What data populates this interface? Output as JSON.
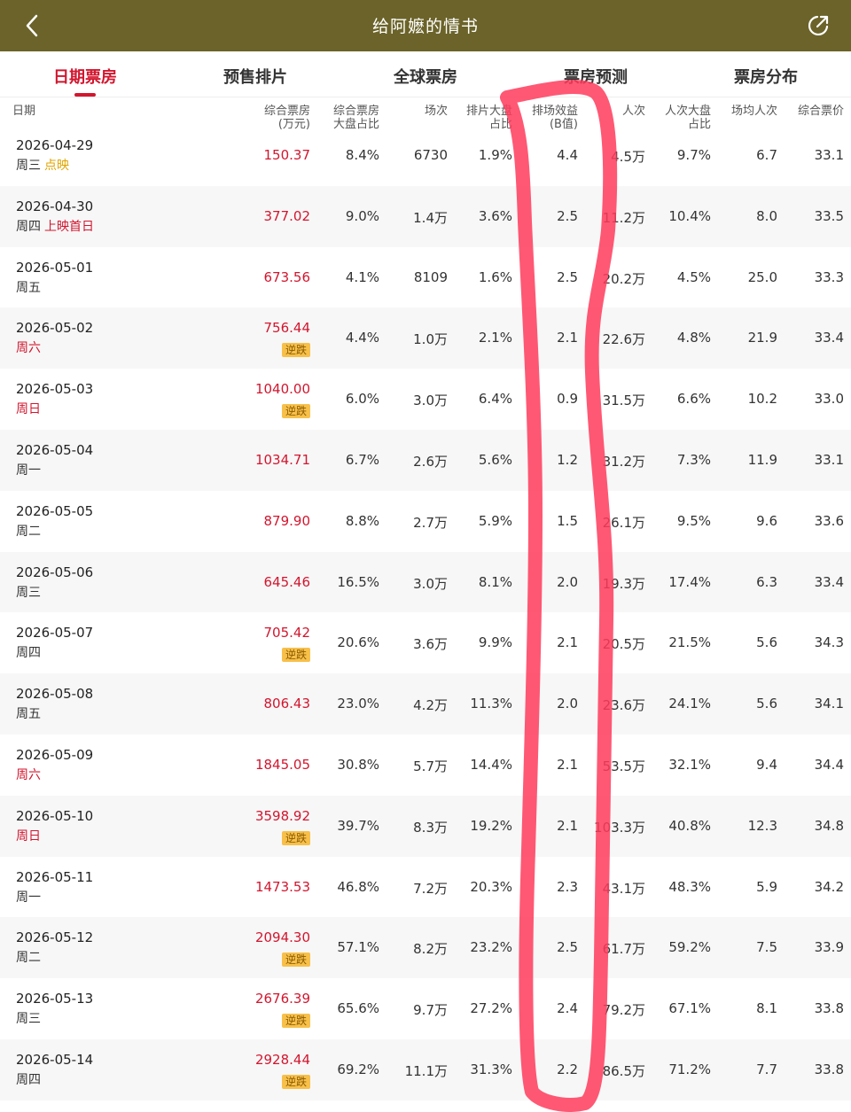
{
  "window": {
    "title": "给阿嬷的情书"
  },
  "tabs": [
    {
      "label": "日期票房",
      "active": true
    },
    {
      "label": "预售排片",
      "active": false
    },
    {
      "label": "全球票房",
      "active": false
    },
    {
      "label": "票房预测",
      "active": false
    },
    {
      "label": "票房分布",
      "active": false
    }
  ],
  "columns": {
    "date": "日期",
    "box_office": "综合票房\n(万元)",
    "bo_share": "综合票房\n大盘占比",
    "shows": "场次",
    "show_share": "排片大盘\n占比",
    "efficiency": "排场效益\n(B值)",
    "admissions": "人次",
    "adm_share": "人次大盘\n占比",
    "avg_adm": "场均人次",
    "avg_price": "综合票价"
  },
  "rows": [
    {
      "date": "2026-04-29",
      "weekday": "周三",
      "weekend": false,
      "tag": "点映",
      "tag_type": "preview",
      "box_office": "150.37",
      "badge": "",
      "bo_share": "8.4%",
      "shows": "6730",
      "show_share": "1.9%",
      "efficiency": "4.4",
      "admissions": "4.5万",
      "adm_share": "9.7%",
      "avg_adm": "6.7",
      "avg_price": "33.1"
    },
    {
      "date": "2026-04-30",
      "weekday": "周四",
      "weekend": false,
      "tag": "上映首日",
      "tag_type": "premiere",
      "box_office": "377.02",
      "badge": "",
      "bo_share": "9.0%",
      "shows": "1.4万",
      "show_share": "3.6%",
      "efficiency": "2.5",
      "admissions": "11.2万",
      "adm_share": "10.4%",
      "avg_adm": "8.0",
      "avg_price": "33.5"
    },
    {
      "date": "2026-05-01",
      "weekday": "周五",
      "weekend": false,
      "tag": "",
      "tag_type": "",
      "box_office": "673.56",
      "badge": "",
      "bo_share": "4.1%",
      "shows": "8109",
      "show_share": "1.6%",
      "efficiency": "2.5",
      "admissions": "20.2万",
      "adm_share": "4.5%",
      "avg_adm": "25.0",
      "avg_price": "33.3"
    },
    {
      "date": "2026-05-02",
      "weekday": "周六",
      "weekend": true,
      "tag": "",
      "tag_type": "",
      "box_office": "756.44",
      "badge": "逆跌",
      "bo_share": "4.4%",
      "shows": "1.0万",
      "show_share": "2.1%",
      "efficiency": "2.1",
      "admissions": "22.6万",
      "adm_share": "4.8%",
      "avg_adm": "21.9",
      "avg_price": "33.4"
    },
    {
      "date": "2026-05-03",
      "weekday": "周日",
      "weekend": true,
      "tag": "",
      "tag_type": "",
      "box_office": "1040.00",
      "badge": "逆跌",
      "bo_share": "6.0%",
      "shows": "3.0万",
      "show_share": "6.4%",
      "efficiency": "0.9",
      "admissions": "31.5万",
      "adm_share": "6.6%",
      "avg_adm": "10.2",
      "avg_price": "33.0"
    },
    {
      "date": "2026-05-04",
      "weekday": "周一",
      "weekend": false,
      "tag": "",
      "tag_type": "",
      "box_office": "1034.71",
      "badge": "",
      "bo_share": "6.7%",
      "shows": "2.6万",
      "show_share": "5.6%",
      "efficiency": "1.2",
      "admissions": "31.2万",
      "adm_share": "7.3%",
      "avg_adm": "11.9",
      "avg_price": "33.1"
    },
    {
      "date": "2026-05-05",
      "weekday": "周二",
      "weekend": false,
      "tag": "",
      "tag_type": "",
      "box_office": "879.90",
      "badge": "",
      "bo_share": "8.8%",
      "shows": "2.7万",
      "show_share": "5.9%",
      "efficiency": "1.5",
      "admissions": "26.1万",
      "adm_share": "9.5%",
      "avg_adm": "9.6",
      "avg_price": "33.6"
    },
    {
      "date": "2026-05-06",
      "weekday": "周三",
      "weekend": false,
      "tag": "",
      "tag_type": "",
      "box_office": "645.46",
      "badge": "",
      "bo_share": "16.5%",
      "shows": "3.0万",
      "show_share": "8.1%",
      "efficiency": "2.0",
      "admissions": "19.3万",
      "adm_share": "17.4%",
      "avg_adm": "6.3",
      "avg_price": "33.4"
    },
    {
      "date": "2026-05-07",
      "weekday": "周四",
      "weekend": false,
      "tag": "",
      "tag_type": "",
      "box_office": "705.42",
      "badge": "逆跌",
      "bo_share": "20.6%",
      "shows": "3.6万",
      "show_share": "9.9%",
      "efficiency": "2.1",
      "admissions": "20.5万",
      "adm_share": "21.5%",
      "avg_adm": "5.6",
      "avg_price": "34.3"
    },
    {
      "date": "2026-05-08",
      "weekday": "周五",
      "weekend": false,
      "tag": "",
      "tag_type": "",
      "box_office": "806.43",
      "badge": "",
      "bo_share": "23.0%",
      "shows": "4.2万",
      "show_share": "11.3%",
      "efficiency": "2.0",
      "admissions": "23.6万",
      "adm_share": "24.1%",
      "avg_adm": "5.6",
      "avg_price": "34.1"
    },
    {
      "date": "2026-05-09",
      "weekday": "周六",
      "weekend": true,
      "tag": "",
      "tag_type": "",
      "box_office": "1845.05",
      "badge": "",
      "bo_share": "30.8%",
      "shows": "5.7万",
      "show_share": "14.4%",
      "efficiency": "2.1",
      "admissions": "53.5万",
      "adm_share": "32.1%",
      "avg_adm": "9.4",
      "avg_price": "34.4"
    },
    {
      "date": "2026-05-10",
      "weekday": "周日",
      "weekend": true,
      "tag": "",
      "tag_type": "",
      "box_office": "3598.92",
      "badge": "逆跌",
      "bo_share": "39.7%",
      "shows": "8.3万",
      "show_share": "19.2%",
      "efficiency": "2.1",
      "admissions": "103.3万",
      "adm_share": "40.8%",
      "avg_adm": "12.3",
      "avg_price": "34.8"
    },
    {
      "date": "2026-05-11",
      "weekday": "周一",
      "weekend": false,
      "tag": "",
      "tag_type": "",
      "box_office": "1473.53",
      "badge": "",
      "bo_share": "46.8%",
      "shows": "7.2万",
      "show_share": "20.3%",
      "efficiency": "2.3",
      "admissions": "43.1万",
      "adm_share": "48.3%",
      "avg_adm": "5.9",
      "avg_price": "34.2"
    },
    {
      "date": "2026-05-12",
      "weekday": "周二",
      "weekend": false,
      "tag": "",
      "tag_type": "",
      "box_office": "2094.30",
      "badge": "逆跌",
      "bo_share": "57.1%",
      "shows": "8.2万",
      "show_share": "23.2%",
      "efficiency": "2.5",
      "admissions": "61.7万",
      "adm_share": "59.2%",
      "avg_adm": "7.5",
      "avg_price": "33.9"
    },
    {
      "date": "2026-05-13",
      "weekday": "周三",
      "weekend": false,
      "tag": "",
      "tag_type": "",
      "box_office": "2676.39",
      "badge": "逆跌",
      "bo_share": "65.6%",
      "shows": "9.7万",
      "show_share": "27.2%",
      "efficiency": "2.4",
      "admissions": "79.2万",
      "adm_share": "67.1%",
      "avg_adm": "8.1",
      "avg_price": "33.8"
    },
    {
      "date": "2026-05-14",
      "weekday": "周四",
      "weekend": false,
      "tag": "",
      "tag_type": "",
      "box_office": "2928.44",
      "badge": "逆跌",
      "bo_share": "69.2%",
      "shows": "11.1万",
      "show_share": "31.3%",
      "efficiency": "2.2",
      "admissions": "86.5万",
      "adm_share": "71.2%",
      "avg_adm": "7.7",
      "avg_price": "33.8"
    }
  ],
  "colors": {
    "titlebar": "#6b6329",
    "accent": "#d2162e",
    "badge": "#f7c04a",
    "annotation": "#ff3b5c"
  },
  "icons": {
    "back": "chevron-left-icon",
    "share": "share-icon"
  }
}
